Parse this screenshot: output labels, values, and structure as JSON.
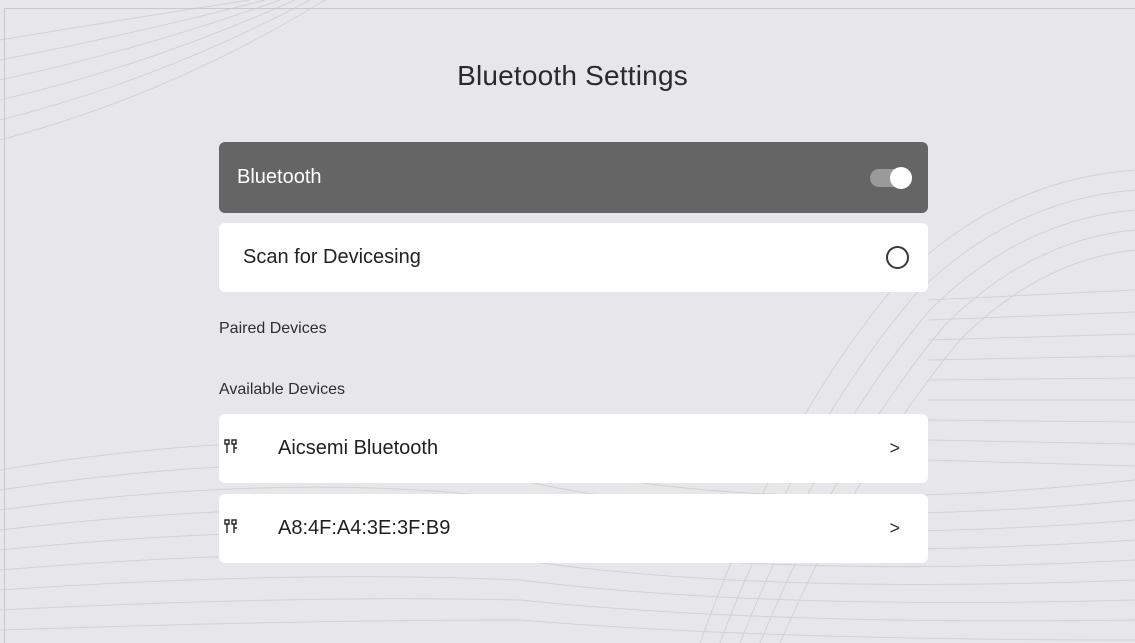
{
  "page": {
    "title": "Bluetooth Settings"
  },
  "bluetooth": {
    "label": "Bluetooth",
    "enabled": true
  },
  "scan": {
    "label": "Scan for Devicesing",
    "icon": "circle-spinner-icon"
  },
  "sections": {
    "paired": "Paired Devices",
    "available": "Available Devices"
  },
  "devices": [
    {
      "name": "Aicsemi Bluetooth",
      "icon": "device-icon",
      "chevron": ">"
    },
    {
      "name": "A8:4F:A4:3E:3F:B9",
      "icon": "device-icon",
      "chevron": ">"
    }
  ],
  "colors": {
    "background": "#e7e7e9",
    "header_row": "#656565",
    "card": "#ffffff"
  }
}
